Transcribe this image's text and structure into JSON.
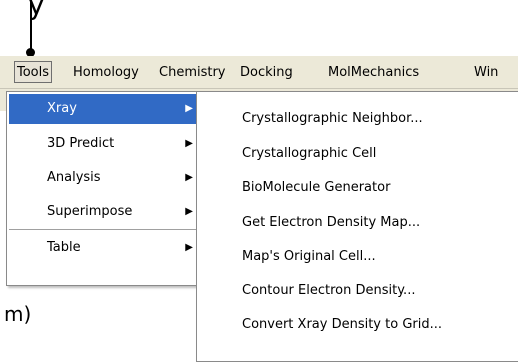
{
  "menubar": {
    "items": [
      {
        "label": "Tools"
      },
      {
        "label": "Homology"
      },
      {
        "label": "Chemistry"
      },
      {
        "label": "Docking"
      },
      {
        "label": "MolMechanics"
      },
      {
        "label": "Win"
      }
    ]
  },
  "background": {
    "top_fragment": "y",
    "text_fragment": "m)"
  },
  "tools_menu": {
    "items": [
      {
        "label": "Xray",
        "submenu": "▶"
      },
      {
        "label": "3D Predict",
        "submenu": "▶"
      },
      {
        "label": "Analysis",
        "submenu": "▶"
      },
      {
        "label": "Superimpose",
        "submenu": "▶"
      },
      {
        "label": "Table",
        "submenu": "▶"
      }
    ]
  },
  "xray_submenu": {
    "items": [
      {
        "label": "Crystallographic Neighbor..."
      },
      {
        "label": "Crystallographic Cell"
      },
      {
        "label": "BioMolecule Generator"
      },
      {
        "label": "Get Electron Density Map..."
      },
      {
        "label": "Map's Original Cell..."
      },
      {
        "label": "Contour Electron Density..."
      },
      {
        "label": "Convert Xray Density to Grid..."
      }
    ]
  }
}
